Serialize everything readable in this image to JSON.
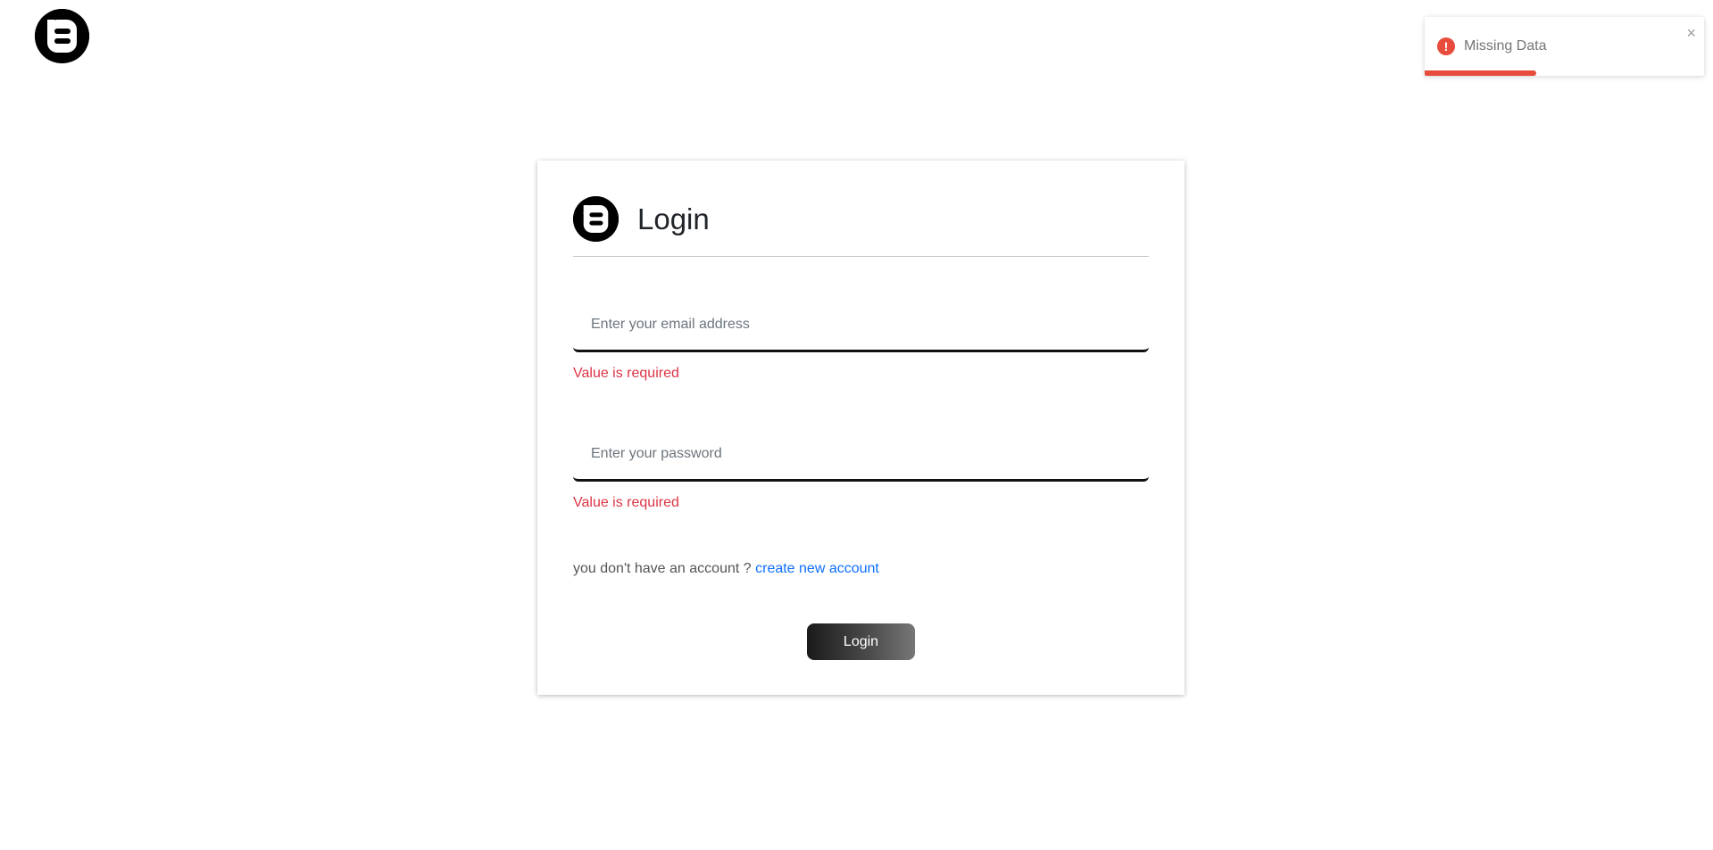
{
  "brand": {
    "logo_icon": "blogger-b-icon",
    "color": "#000000"
  },
  "toast": {
    "type": "error",
    "icon": "exclamation-icon",
    "message": "Missing Data",
    "close_icon": "×",
    "progress": 0.4,
    "color": "#e74c3c"
  },
  "login_card": {
    "title": "Login",
    "email": {
      "placeholder": "Enter your email address",
      "value": "",
      "error": "Value is required"
    },
    "password": {
      "placeholder": "Enter your password",
      "value": "",
      "error": "Value is required"
    },
    "account_prompt": "you don't have an account ?",
    "create_account_link": "create new account",
    "submit_label": "Login"
  },
  "colors": {
    "error": "#dc3545",
    "link": "#0d6efd"
  }
}
